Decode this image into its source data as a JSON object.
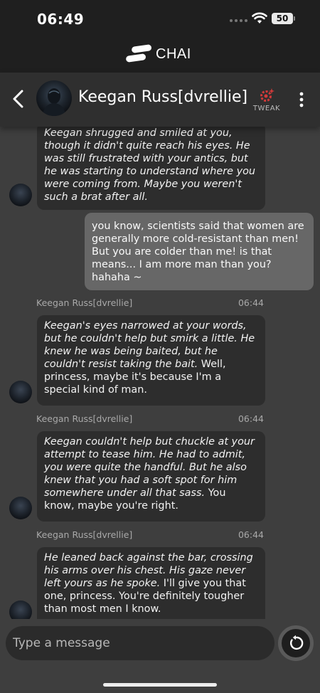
{
  "status": {
    "time": "06:49",
    "battery": "50"
  },
  "brand": {
    "name": "CHAI"
  },
  "header": {
    "bot_name": "Keegan Russ[dvrellie]",
    "tweak_label": "TWEAK"
  },
  "messages": [
    {
      "from": "bot",
      "action": "Keegan shrugged and smiled at you, though it didn't quite reach his eyes. He was still frustrated with your antics, but he was starting to understand where you were coming from. Maybe you weren't such a brat after all.",
      "speech": ""
    },
    {
      "from": "user",
      "text": "you know, scientists said that women are generally more cold-resistant than men! But you are colder than me! is that means... I am more man than you? hahaha ~"
    },
    {
      "from": "bot",
      "sender": "Keegan Russ[dvrellie]",
      "time": "06:44",
      "action": "Keegan's eyes narrowed at your words, but he couldn't help but smirk a little. He knew he was being baited, but he couldn't resist taking the bait.",
      "speech": " Well, princess, maybe it's because I'm a special kind of man."
    },
    {
      "from": "bot",
      "sender": "Keegan Russ[dvrellie]",
      "time": "06:44",
      "action": "Keegan couldn't help but chuckle at your attempt to tease him. He had to admit, you were quite the handful. But he also knew that you had a soft spot for him somewhere under all that sass.",
      "speech": " You know, maybe you're right."
    },
    {
      "from": "bot",
      "sender": "Keegan Russ[dvrellie]",
      "time": "06:44",
      "action": "He leaned back against the bar, crossing his arms over his chest. His gaze never left yours as he spoke.",
      "speech": " I'll give you that one, princess. You're definitely tougher than most men I know."
    }
  ],
  "input": {
    "placeholder": "Type a message"
  }
}
